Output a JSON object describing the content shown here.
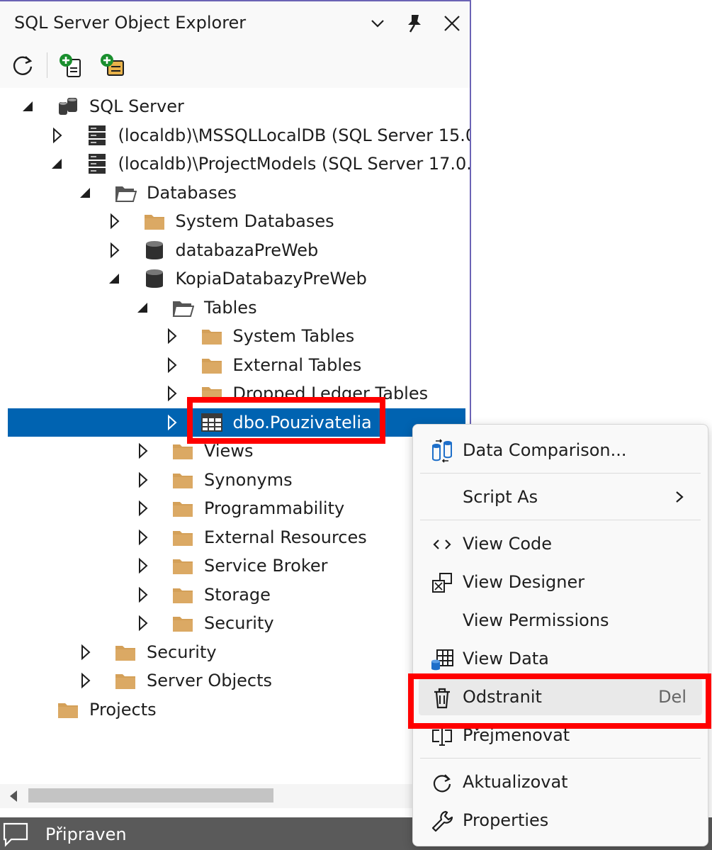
{
  "panel": {
    "title": "SQL Server Object Explorer"
  },
  "tree": [
    {
      "label": "SQL Server",
      "level": 0,
      "arrow": "expanded",
      "icon": "servers-icon"
    },
    {
      "label": "(localdb)\\MSSQLLocalDB (SQL Server 15.0",
      "level": 1,
      "arrow": "collapsed",
      "icon": "server-icon"
    },
    {
      "label": "(localdb)\\ProjectModels (SQL Server 17.0.",
      "level": 1,
      "arrow": "expanded",
      "icon": "server-icon"
    },
    {
      "label": "Databases",
      "level": 2,
      "arrow": "expanded",
      "icon": "folder-open-icon"
    },
    {
      "label": "System Databases",
      "level": 3,
      "arrow": "collapsed",
      "icon": "folder-icon"
    },
    {
      "label": "databazaPreWeb",
      "level": 3,
      "arrow": "collapsed",
      "icon": "database-icon"
    },
    {
      "label": "KopiaDatabazyPreWeb",
      "level": 3,
      "arrow": "expanded",
      "icon": "database-icon"
    },
    {
      "label": "Tables",
      "level": 4,
      "arrow": "expanded",
      "icon": "folder-open-icon"
    },
    {
      "label": "System Tables",
      "level": 5,
      "arrow": "collapsed",
      "icon": "folder-icon"
    },
    {
      "label": "External Tables",
      "level": 5,
      "arrow": "collapsed",
      "icon": "folder-icon"
    },
    {
      "label": "Dropped Ledger Tables",
      "level": 5,
      "arrow": "collapsed",
      "icon": "folder-icon"
    },
    {
      "label": "dbo.Pouzivatelia",
      "level": 5,
      "arrow": "collapsed",
      "icon": "table-icon",
      "selected": true
    },
    {
      "label": "Views",
      "level": 4,
      "arrow": "collapsed",
      "icon": "folder-icon"
    },
    {
      "label": "Synonyms",
      "level": 4,
      "arrow": "collapsed",
      "icon": "folder-icon"
    },
    {
      "label": "Programmability",
      "level": 4,
      "arrow": "collapsed",
      "icon": "folder-icon"
    },
    {
      "label": "External Resources",
      "level": 4,
      "arrow": "collapsed",
      "icon": "folder-icon"
    },
    {
      "label": "Service Broker",
      "level": 4,
      "arrow": "collapsed",
      "icon": "folder-icon"
    },
    {
      "label": "Storage",
      "level": 4,
      "arrow": "collapsed",
      "icon": "folder-icon"
    },
    {
      "label": "Security",
      "level": 4,
      "arrow": "collapsed",
      "icon": "folder-icon"
    },
    {
      "label": "Security",
      "level": 2,
      "arrow": "collapsed",
      "icon": "folder-icon"
    },
    {
      "label": "Server Objects",
      "level": 2,
      "arrow": "collapsed",
      "icon": "folder-icon"
    },
    {
      "label": "Projects",
      "level": 0,
      "arrow": "none",
      "icon": "folder-icon"
    }
  ],
  "context_menu": [
    {
      "label": "Data Comparison...",
      "icon": "data-compare-icon"
    },
    {
      "separator": true
    },
    {
      "label": "Script As",
      "icon": "none",
      "submenu": true
    },
    {
      "separator": true
    },
    {
      "label": "View Code",
      "icon": "code-icon"
    },
    {
      "label": "View Designer",
      "icon": "designer-icon"
    },
    {
      "label": "View Permissions",
      "icon": "none"
    },
    {
      "label": "View Data",
      "icon": "view-data-icon"
    },
    {
      "label": "Odstranit",
      "icon": "trash-icon",
      "shortcut": "Del",
      "hover": true
    },
    {
      "label": "Přejmenovat",
      "icon": "rename-icon"
    },
    {
      "separator": true
    },
    {
      "label": "Aktualizovat",
      "icon": "refresh-icon"
    },
    {
      "label": "Properties",
      "icon": "wrench-icon"
    }
  ],
  "status": {
    "text": "Připraven"
  },
  "colors": {
    "selection": "#0063b1",
    "highlight": "#ff0000",
    "folder": "#d4a058",
    "status_bar": "#5a5a5a"
  }
}
